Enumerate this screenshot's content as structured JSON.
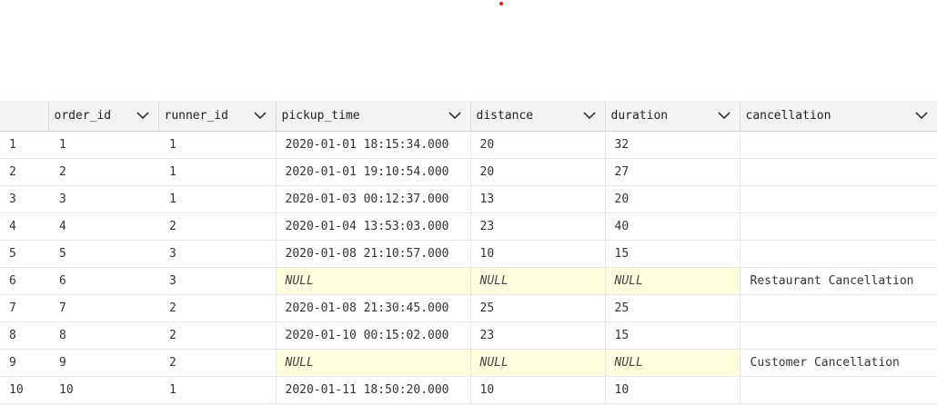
{
  "columns": {
    "rownum": "",
    "order_id": "order_id",
    "runner_id": "runner_id",
    "pickup_time": "pickup_time",
    "distance": "distance",
    "duration": "duration",
    "cancellation": "cancellation"
  },
  "rows": [
    {
      "rownum": "1",
      "order_id": "1",
      "runner_id": "1",
      "pickup_time": "2020-01-01 18:15:34.000",
      "distance": "20",
      "duration": "32",
      "cancellation": ""
    },
    {
      "rownum": "2",
      "order_id": "2",
      "runner_id": "1",
      "pickup_time": "2020-01-01 19:10:54.000",
      "distance": "20",
      "duration": "27",
      "cancellation": ""
    },
    {
      "rownum": "3",
      "order_id": "3",
      "runner_id": "1",
      "pickup_time": "2020-01-03 00:12:37.000",
      "distance": "13",
      "duration": "20",
      "cancellation": ""
    },
    {
      "rownum": "4",
      "order_id": "4",
      "runner_id": "2",
      "pickup_time": "2020-01-04 13:53:03.000",
      "distance": "23",
      "duration": "40",
      "cancellation": ""
    },
    {
      "rownum": "5",
      "order_id": "5",
      "runner_id": "3",
      "pickup_time": "2020-01-08 21:10:57.000",
      "distance": "10",
      "duration": "15",
      "cancellation": ""
    },
    {
      "rownum": "6",
      "order_id": "6",
      "runner_id": "3",
      "pickup_time": "NULL",
      "distance": "NULL",
      "duration": "NULL",
      "cancellation": "Restaurant Cancellation"
    },
    {
      "rownum": "7",
      "order_id": "7",
      "runner_id": "2",
      "pickup_time": "2020-01-08 21:30:45.000",
      "distance": "25",
      "duration": "25",
      "cancellation": ""
    },
    {
      "rownum": "8",
      "order_id": "8",
      "runner_id": "2",
      "pickup_time": "2020-01-10 00:15:02.000",
      "distance": "23",
      "duration": "15",
      "cancellation": ""
    },
    {
      "rownum": "9",
      "order_id": "9",
      "runner_id": "2",
      "pickup_time": "NULL",
      "distance": "NULL",
      "duration": "NULL",
      "cancellation": "Customer Cancellation"
    },
    {
      "rownum": "10",
      "order_id": "10",
      "runner_id": "1",
      "pickup_time": "2020-01-11 18:50:20.000",
      "distance": "10",
      "duration": "10",
      "cancellation": ""
    }
  ],
  "colors": {
    "header_bg": "#f3f3f3",
    "null_bg": "#ffffe0",
    "grid_line": "#e6e6e6",
    "marker": "#e02020"
  },
  "icons": {
    "sort_dropdown": "chevron-down-icon"
  }
}
